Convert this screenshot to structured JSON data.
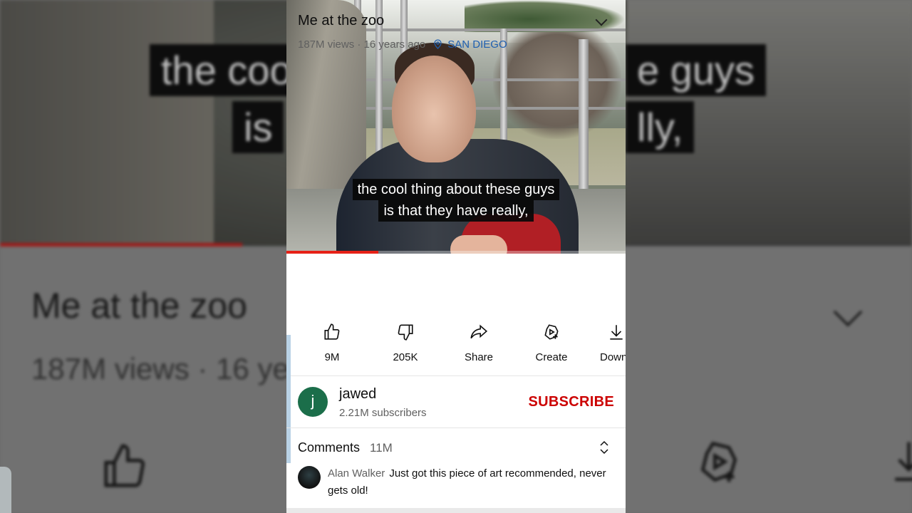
{
  "video": {
    "caption_line1": "the cool thing about these guys",
    "caption_line2": "is that they have really,",
    "progress_fraction": 0.27
  },
  "info": {
    "title": "Me at the zoo",
    "views_age": "187M views · 16 years ago",
    "location": "SAN DIEGO"
  },
  "actions": [
    {
      "label": "9M",
      "icon": "like-icon"
    },
    {
      "label": "205K",
      "icon": "dislike-icon"
    },
    {
      "label": "Share",
      "icon": "share-icon"
    },
    {
      "label": "Create",
      "icon": "create-icon"
    },
    {
      "label": "Download",
      "icon": "download-icon"
    }
  ],
  "channel": {
    "avatar_letter": "j",
    "name": "jawed",
    "subscribers": "2.21M subscribers",
    "subscribe_label": "SUBSCRIBE"
  },
  "comments": {
    "heading": "Comments",
    "count": "11M",
    "top_comment": {
      "author": "Alan Walker",
      "text": "Just got this piece of art recommended, never gets old!"
    }
  },
  "background": {
    "cap_line1_left": "the coo",
    "cap_line1_right": "e guys",
    "cap_line2_left": "is",
    "cap_line2_right": "lly,",
    "title": "Me at the zoo",
    "views": "187M views · 16 ye"
  },
  "colors": {
    "accent": "#cc0000",
    "progress": "#e62117",
    "location": "#1e5fb0",
    "avatar": "#1b6e4a"
  }
}
